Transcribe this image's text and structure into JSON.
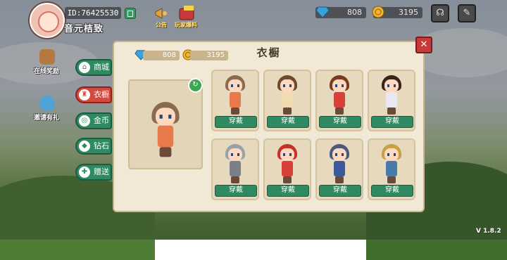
{
  "header": {
    "user_id": "ID:76425530",
    "user_name": "音元桔致",
    "icons": [
      {
        "name": "announcement",
        "label": "公告"
      },
      {
        "name": "event",
        "label": "玩家爆料"
      }
    ],
    "diamonds": "808",
    "coins": "3195"
  },
  "side_buttons": [
    {
      "label": "在线奖励"
    },
    {
      "label": "邀请有礼"
    }
  ],
  "panel": {
    "title": "衣橱",
    "diamonds": "808",
    "coins": "3195",
    "tabs": [
      {
        "label": "商城",
        "icon": "shop-icon",
        "active": false
      },
      {
        "label": "衣橱",
        "icon": "wardrobe-icon",
        "active": true
      },
      {
        "label": "金币",
        "icon": "coin-icon",
        "active": false
      },
      {
        "label": "钻石",
        "icon": "diamond-icon",
        "active": false
      },
      {
        "label": "赠送",
        "icon": "gift-icon",
        "active": false
      }
    ],
    "outfits": [
      {
        "button": "穿戴",
        "hair": "#8b6a4f",
        "outfit": "#e7794a"
      },
      {
        "button": "穿戴",
        "hair": "#6b4a2f",
        "outfit": "#f0dcb0"
      },
      {
        "button": "穿戴",
        "hair": "#7a3b1f",
        "outfit": "#d8413a"
      },
      {
        "button": "穿戴",
        "hair": "#3a2418",
        "outfit": "#e8e8f0"
      },
      {
        "button": "穿戴",
        "hair": "#9aa0a8",
        "outfit": "#7a7f8a"
      },
      {
        "button": "穿戴",
        "hair": "#c8302a",
        "outfit": "#d8403a"
      },
      {
        "button": "穿戴",
        "hair": "#4a5a7a",
        "outfit": "#3a5a9a"
      },
      {
        "button": "穿戴",
        "hair": "#c9a042",
        "outfit": "#4a7aa8"
      }
    ]
  },
  "version": "V 1.8.2",
  "colors": {
    "accent_green": "#2f8a62",
    "accent_red": "#d2493e",
    "panel_bg": "#f1e9d6"
  }
}
